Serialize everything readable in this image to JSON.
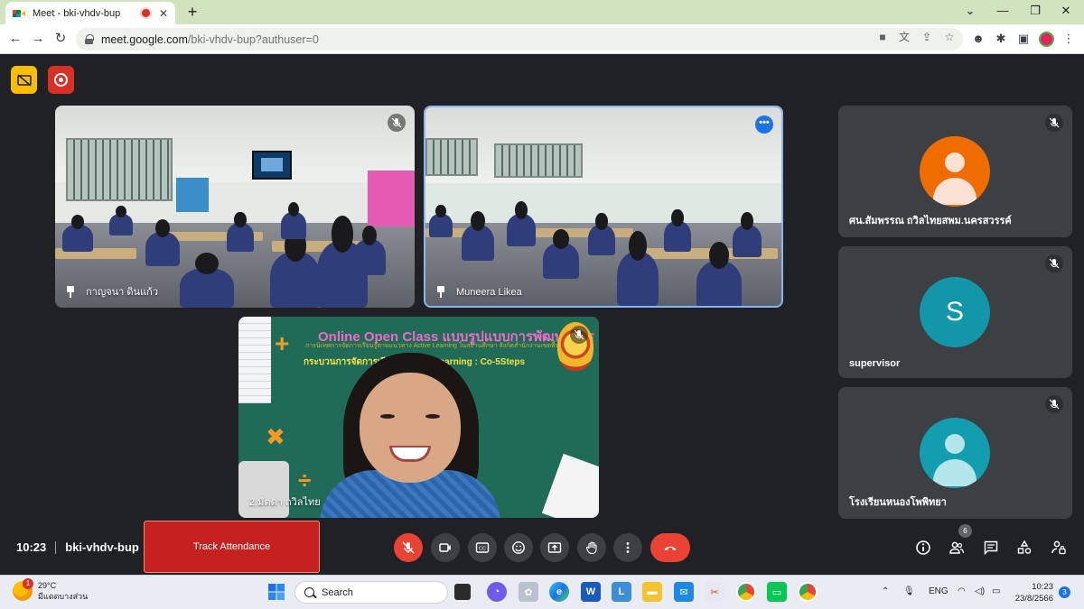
{
  "browser": {
    "tab_title": "Meet - bki-vhdv-bup",
    "url_host": "meet.google.com",
    "url_path": "/bki-vhdv-bup?authuser=0"
  },
  "tiles": {
    "tile1_name": "กาญจนา ดินแก้ว",
    "tile2_name": "Muneera Likea",
    "presenter_name": "2.มัตดา ถวิลไทย"
  },
  "slide": {
    "title": "Online Open Class แบบรูปแบบการพัฒนาการ",
    "subtitle": "การนิเทศการจัดการเรียนรู้ตามแนวทาง Active Learning ในสถานศึกษา สังกัดสำนักงานเขตพื้นที่การศึกษา",
    "line3": "กระบวนการจัดการเรียนรู้ Active Learning : Co-5Steps"
  },
  "participants": [
    {
      "name": "ศน.สัมพรรณ ถวิลไทยสพม.นครสวรรค์",
      "avatar_color": "#ef6c00",
      "avatar_type": "person-icon"
    },
    {
      "name": "supervisor",
      "avatar_color": "#1296a8",
      "avatar_type": "letter",
      "letter": "S"
    },
    {
      "name": "โรงเรียนหนองโพพิทยา",
      "avatar_color": "#129eaf",
      "avatar_type": "person-icon"
    }
  ],
  "bottom_bar": {
    "time": "10:23",
    "meeting_code": "bki-vhdv-bup",
    "track_attendance": "Track Attendance",
    "participant_count": "6"
  },
  "taskbar": {
    "temperature": "29°C",
    "weather_desc": "มีแดดบางส่วน",
    "weather_badge": "1",
    "search_label": "Search",
    "language": "ENG",
    "clock_time": "10:23",
    "clock_date": "23/8/2566",
    "notification_count": "3"
  },
  "colors": {
    "meet_bg": "#202124",
    "tile_bg": "#3c4043",
    "hangup_red": "#ea4335",
    "accent_blue": "#8ab4f8"
  }
}
